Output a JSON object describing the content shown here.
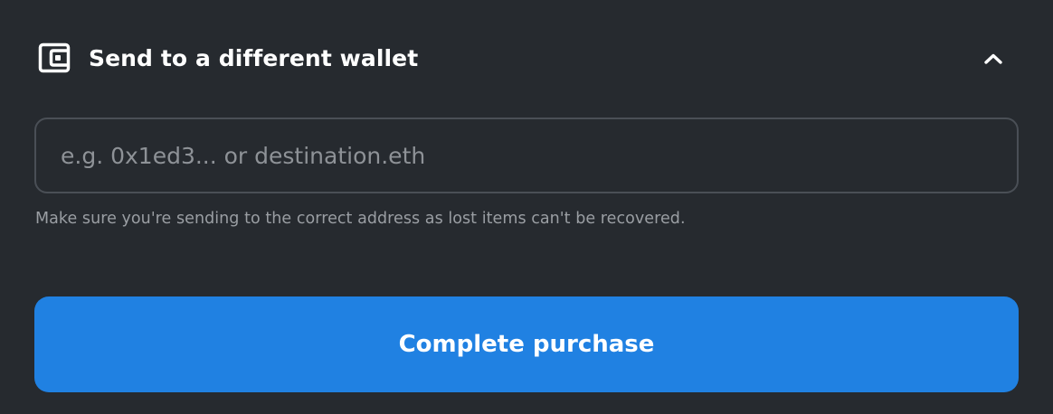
{
  "section": {
    "title": "Send to a different wallet",
    "icon": "wallet-icon",
    "toggle_icon": "chevron-up-icon",
    "expanded": true
  },
  "address_field": {
    "value": "",
    "placeholder": "e.g. 0x1ed3... or destination.eth"
  },
  "helper_text": "Make sure you're sending to the correct address as lost items can't be recovered.",
  "submit": {
    "label": "Complete purchase"
  },
  "colors": {
    "background": "#262a2f",
    "accent": "#2081e2",
    "border": "#4a4f56",
    "text_primary": "#ffffff",
    "text_muted": "#9a9ea3"
  }
}
